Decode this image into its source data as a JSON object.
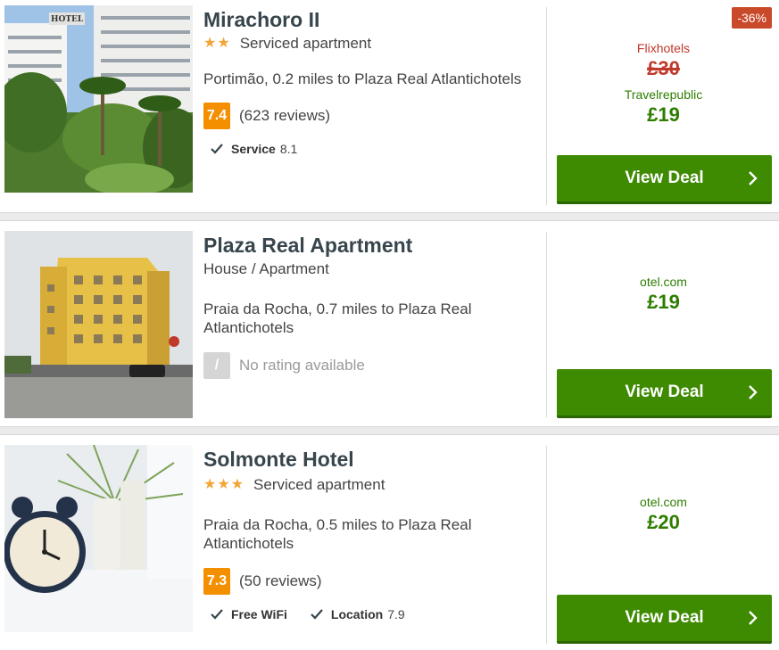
{
  "hotels": [
    {
      "name": "Mirachoro II",
      "stars": "★★",
      "type": "Serviced apartment",
      "location": "Portimão, 0.2 miles to Plaza Real Atlantichotels",
      "score": "7.4",
      "reviews": "(623 reviews)",
      "features": [
        {
          "label": "Service",
          "value": "8.1"
        }
      ],
      "discount": "-36%",
      "old_provider": "Flixhotels",
      "old_price": "£30",
      "provider": "Travelrepublic",
      "price": "£19",
      "deal_label": "View Deal"
    },
    {
      "name": "Plaza Real Apartment",
      "type": "House / Apartment",
      "location_line1": "Praia da Rocha, 0.7 miles to Plaza Real",
      "location_line2": "Atlantichotels",
      "score": "/",
      "no_rating": "No rating available",
      "provider": "otel.com",
      "price": "£19",
      "deal_label": "View Deal"
    },
    {
      "name": "Solmonte Hotel",
      "stars": "★★★",
      "type": "Serviced apartment",
      "location_line1": "Praia da Rocha, 0.5 miles to Plaza Real",
      "location_line2": "Atlantichotels",
      "score": "7.3",
      "reviews": "(50 reviews)",
      "features": [
        {
          "label": "Free WiFi",
          "value": ""
        },
        {
          "label": "Location",
          "value": "7.9"
        }
      ],
      "provider": "otel.com",
      "price": "£20",
      "deal_label": "View Deal"
    }
  ],
  "photo_labels": {
    "hotel_sign": "HOTEL"
  },
  "colors": {
    "accent_green": "#3e8a00",
    "score_orange": "#f48f00",
    "discount_red": "#c94a2b"
  }
}
